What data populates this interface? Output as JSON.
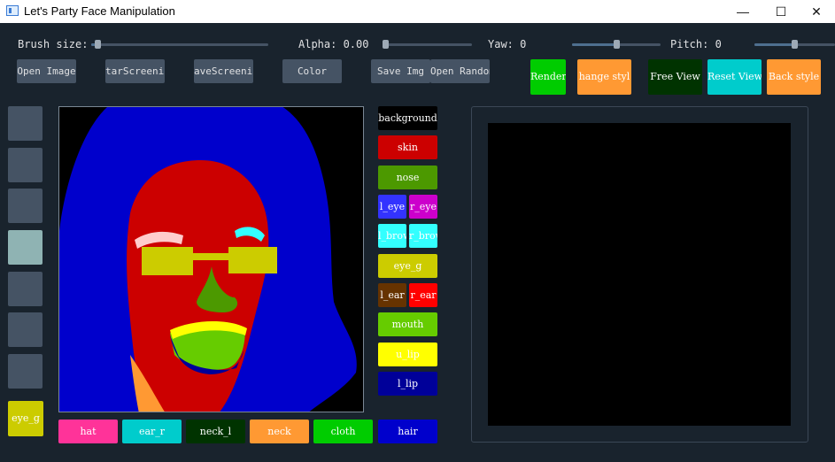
{
  "window": {
    "title": "Let's Party Face Manipulation",
    "controls": {
      "minimize": "—",
      "maximize": "☐",
      "close": "✕"
    }
  },
  "params": {
    "brush_label": "Brush size:",
    "brush_value": 0.02,
    "alpha_label": "Alpha: 0.00",
    "alpha_value": 0.0,
    "yaw_label": "Yaw: 0",
    "yaw_value": 0.5,
    "pitch_label": "Pitch: 0",
    "pitch_value": 0.5
  },
  "toolbar": {
    "open_image": "Open Image",
    "start_screening": "tarScreenin",
    "save_screening": "aveScreenin",
    "color": "Color",
    "save_img": "Save Img",
    "open_random": "Open Random",
    "render": "Render",
    "change_style": "hange styl",
    "free_view": "Free View",
    "reset_view": "Reset View",
    "back_style": "Back style"
  },
  "left_swatches": {
    "eye_g": "eye_g"
  },
  "labels_right": {
    "background": "background",
    "skin": "skin",
    "nose": "nose",
    "l_eye": "l_eye",
    "r_eye": "r_eye",
    "l_brow": "l_brow",
    "r_brow": "r_brow",
    "eye_g": "eye_g",
    "l_ear": "l_ear",
    "r_ear": "r_ear",
    "mouth": "mouth",
    "u_lip": "u_lip",
    "l_lip": "l_lip"
  },
  "labels_bottom": {
    "hat": "hat",
    "ear_r": "ear_r",
    "neck_l": "neck_l",
    "neck": "neck",
    "cloth": "cloth",
    "hair": "hair"
  },
  "colors": {
    "background": "#000000",
    "skin": "#cc0000",
    "nose": "#4c9900",
    "l_eye": "#3333ff",
    "r_eye": "#cc00cc",
    "l_brow": "#33ffff",
    "r_brow": "#33ffff",
    "eye_g": "#cccc00",
    "l_ear": "#663300",
    "r_ear": "#ff0000",
    "mouth": "#66cc00",
    "u_lip": "#ffff00",
    "l_lip": "#000099",
    "hat": "#ff3399",
    "ear_r": "#00cccc",
    "neck_l": "#003300",
    "neck": "#ff9933",
    "cloth": "#00cc00",
    "hair": "#0000cc",
    "swatch_selected": "#8fb3b3"
  }
}
